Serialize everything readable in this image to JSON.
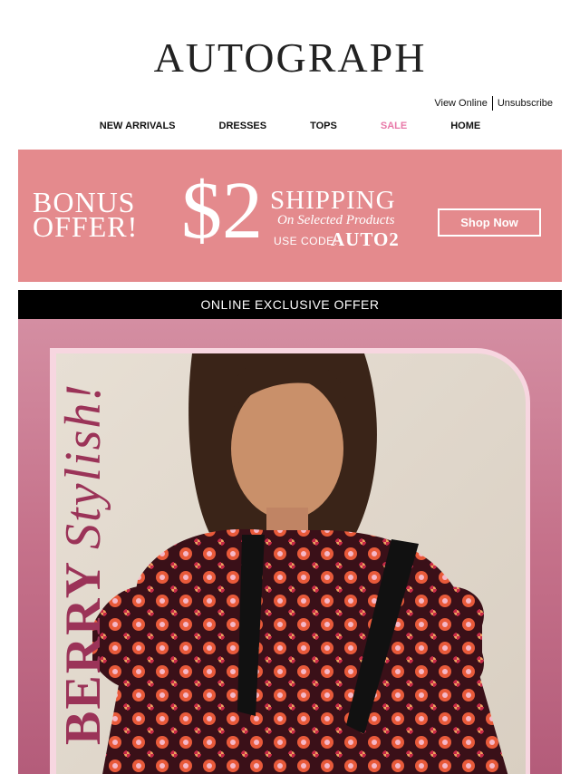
{
  "brand": {
    "logo": "AUTOGRAPH"
  },
  "utility": {
    "view_online": "View Online",
    "unsubscribe": "Unsubscribe"
  },
  "nav": {
    "items": [
      {
        "label": "NEW ARRIVALS"
      },
      {
        "label": "DRESSES"
      },
      {
        "label": "TOPS"
      },
      {
        "label": "SALE",
        "color": "#e878a8"
      },
      {
        "label": "HOME"
      }
    ]
  },
  "promo": {
    "bonus_line1": "BONUS",
    "bonus_line2": "OFFER!",
    "amount": "$2",
    "shipping": "SHIPPING",
    "subtitle": "On Selected Products",
    "code_label": "USE CODE:",
    "code": "AUTO2",
    "cta": "Shop Now",
    "bg_color": "#e48a8d"
  },
  "exclusive": {
    "label": "ONLINE EXCLUSIVE OFFER"
  },
  "hero": {
    "word_bold": "BERRY",
    "word_script": "Stylish!",
    "accent_color": "#9b3358"
  }
}
